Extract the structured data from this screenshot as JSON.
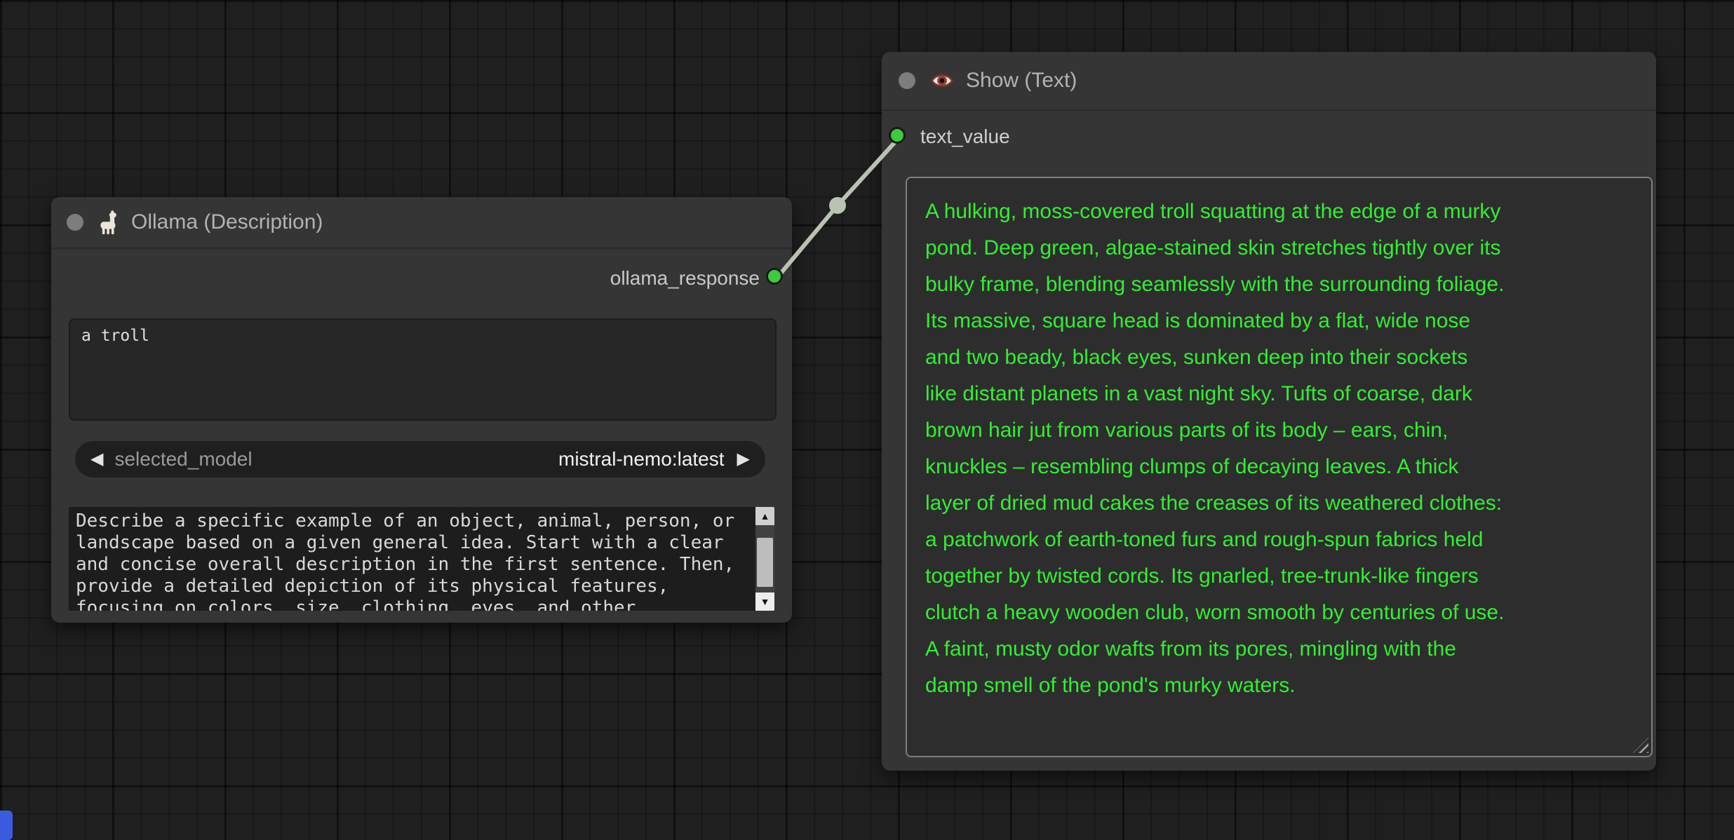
{
  "canvas": {
    "background_color": "#1f1f1f",
    "grid_line_color": "#161616",
    "offscreen_fragment_color": "#3c5ce0"
  },
  "link": {
    "color": "#b9c3b2",
    "slot_color": "#3ecb3e",
    "from_slot": "ollama_response",
    "to_slot": "text_value"
  },
  "ollama_node": {
    "title": "Ollama (Description)",
    "output_label": "ollama_response",
    "prompt_text": "a troll",
    "model_widget": {
      "prev_icon": "◀",
      "label": "selected_model",
      "value": "mistral-nemo:latest",
      "next_icon": "▶"
    },
    "system_prompt": "Describe a specific example of an object, animal, person, or\nlandscape based on a given general idea. Start with a clear\nand concise overall description in the first sentence. Then,\nprovide a detailed depiction of its physical features,\nfocusing on colors, size, clothing, eyes, and other",
    "scrollbar": {
      "up_icon": "▲",
      "down_icon": "▼"
    }
  },
  "show_node": {
    "title": "Show (Text)",
    "input_label": "text_value",
    "text_color": "#33ee33",
    "text": "A hulking, moss-covered troll squatting at the edge of a murky\npond. Deep green, algae-stained skin stretches tightly over its\nbulky frame, blending seamlessly with the surrounding foliage.\nIts massive, square head is dominated by a flat, wide nose\nand two beady, black eyes, sunken deep into their sockets\nlike distant planets in a vast night sky. Tufts of coarse, dark\nbrown hair jut from various parts of its body – ears, chin,\nknuckles – resembling clumps of decaying leaves. A thick\nlayer of dried mud cakes the creases of its weathered clothes:\na patchwork of earth-toned furs and rough-spun fabrics held\ntogether by twisted cords. Its gnarled, tree-trunk-like fingers\nclutch a heavy wooden club, worn smooth by centuries of use.\nA faint, musty odor wafts from its pores, mingling with the\ndamp smell of the pond's murky waters."
  }
}
